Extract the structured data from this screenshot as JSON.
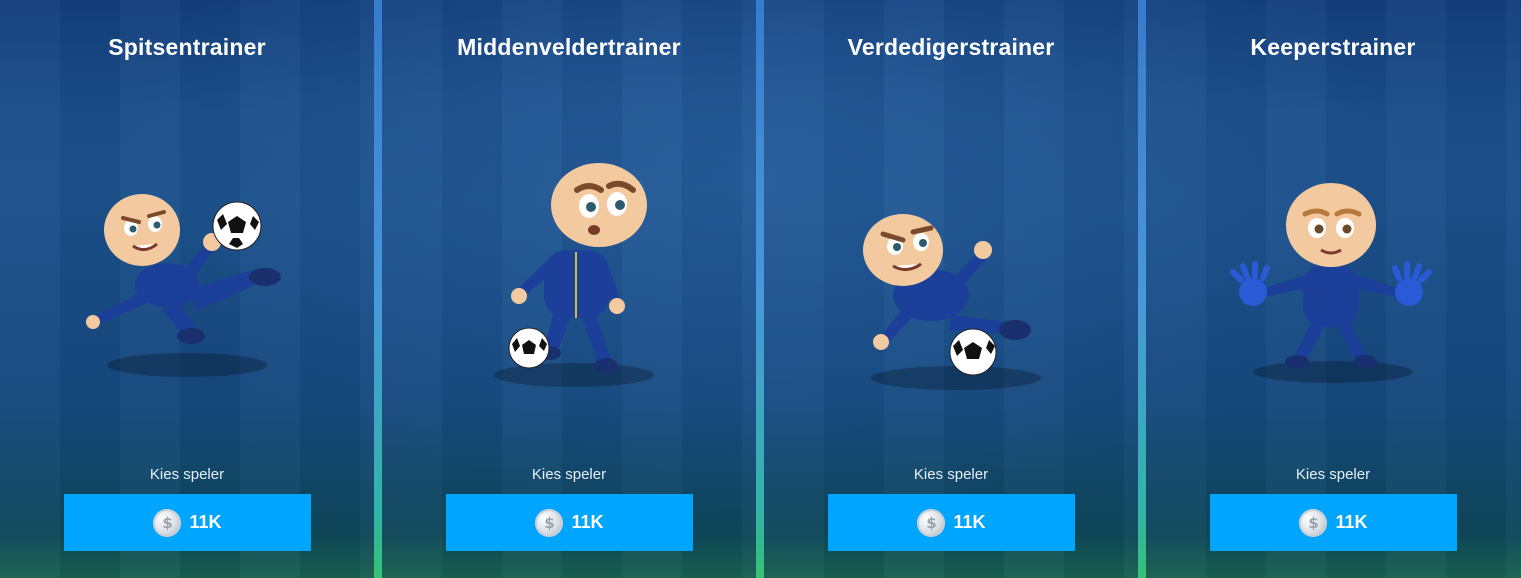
{
  "cards": [
    {
      "title": "Spitsentrainer",
      "choose_label": "Kies speler",
      "price": "11K",
      "coin_symbol": "$",
      "pose": "volley-kick"
    },
    {
      "title": "Middenveldertrainer",
      "choose_label": "Kies speler",
      "price": "11K",
      "coin_symbol": "$",
      "pose": "dribble"
    },
    {
      "title": "Verdedigerstrainer",
      "choose_label": "Kies speler",
      "price": "11K",
      "coin_symbol": "$",
      "pose": "slide-tackle"
    },
    {
      "title": "Keeperstrainer",
      "choose_label": "Kies speler",
      "price": "11K",
      "coin_symbol": "$",
      "pose": "goalkeeper-stance"
    }
  ],
  "colors": {
    "button": "#00a5ff",
    "tracksuit": "#1c3f9a",
    "skin": "#f3c9a0",
    "divider": "#4fa3e8"
  }
}
